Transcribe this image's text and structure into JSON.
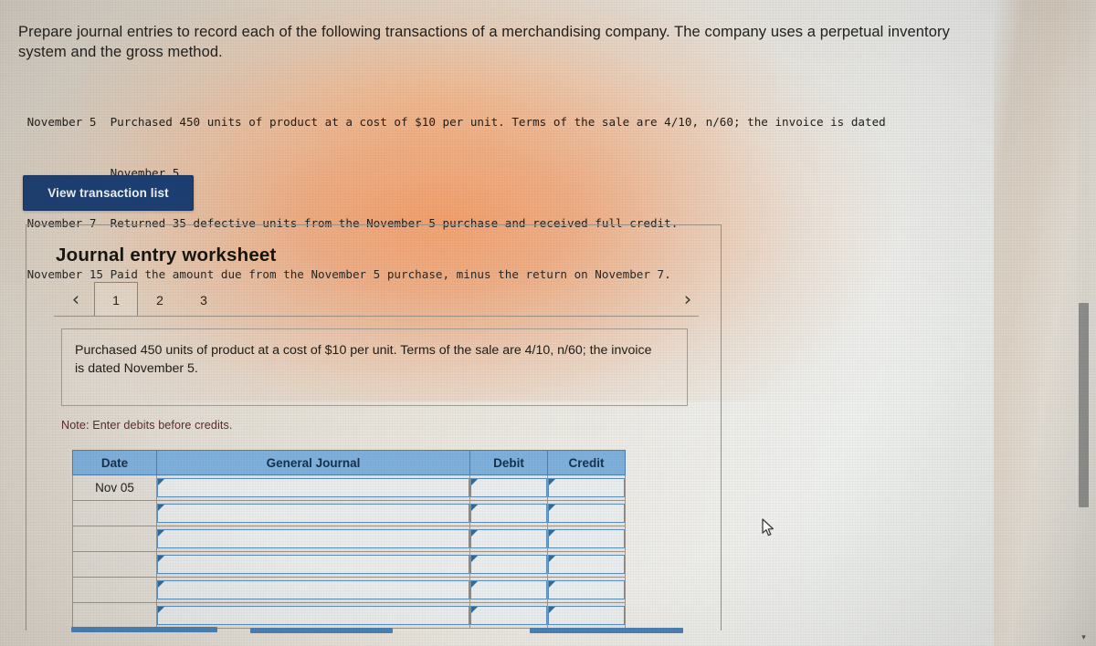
{
  "question": {
    "prompt": "Prepare journal entries to record each of the following transactions of a merchandising company. The company uses a perpetual inventory system and the gross method."
  },
  "transactions": [
    {
      "date": "November 5",
      "text": "Purchased 450 units of product at a cost of $10 per unit. Terms of the sale are 4/10, n/60; the invoice is dated"
    },
    {
      "date": "",
      "text": "November 5."
    },
    {
      "date": "November 7",
      "text": "Returned 35 defective units from the November 5 purchase and received full credit."
    },
    {
      "date": "November 15",
      "text": "Paid the amount due from the November 5 purchase, minus the return on November 7."
    }
  ],
  "transactions_raw": [
    " November 5  Purchased 450 units of product at a cost of $10 per unit. Terms of the sale are 4/10, n/60; the invoice is dated",
    "             November 5.",
    " November 7  Returned 35 defective units from the November 5 purchase and received full credit.",
    " November 15 Paid the amount due from the November 5 purchase, minus the return on November 7."
  ],
  "buttons": {
    "view_transaction_list": "View transaction list"
  },
  "worksheet": {
    "title": "Journal entry worksheet",
    "nav": {
      "prev": "‹",
      "next": "›"
    },
    "tabs": [
      {
        "label": "1",
        "active": true
      },
      {
        "label": "2",
        "active": false
      },
      {
        "label": "3",
        "active": false
      }
    ],
    "instruction": "Purchased 450 units of product at a cost of $10 per unit. Terms of the sale are 4/10, n/60; the invoice is dated November 5.",
    "note": "Note: Enter debits before credits.",
    "table": {
      "headers": [
        "Date",
        "General Journal",
        "Debit",
        "Credit"
      ],
      "rows": [
        {
          "date": "Nov 05",
          "general_journal": "",
          "debit": "",
          "credit": ""
        },
        {
          "date": "",
          "general_journal": "",
          "debit": "",
          "credit": ""
        },
        {
          "date": "",
          "general_journal": "",
          "debit": "",
          "credit": ""
        },
        {
          "date": "",
          "general_journal": "",
          "debit": "",
          "credit": ""
        },
        {
          "date": "",
          "general_journal": "",
          "debit": "",
          "credit": ""
        },
        {
          "date": "",
          "general_journal": "",
          "debit": "",
          "credit": ""
        }
      ]
    }
  },
  "colors": {
    "button_navy": "#1c3f72",
    "table_header_blue": "#7fb0dc",
    "input_border_blue": "#5b8fbe",
    "note_maroon": "#5d2b2b",
    "bottom_bar_blue": "#4a81b4"
  },
  "scrollbar": {
    "down_arrow": "▾"
  }
}
